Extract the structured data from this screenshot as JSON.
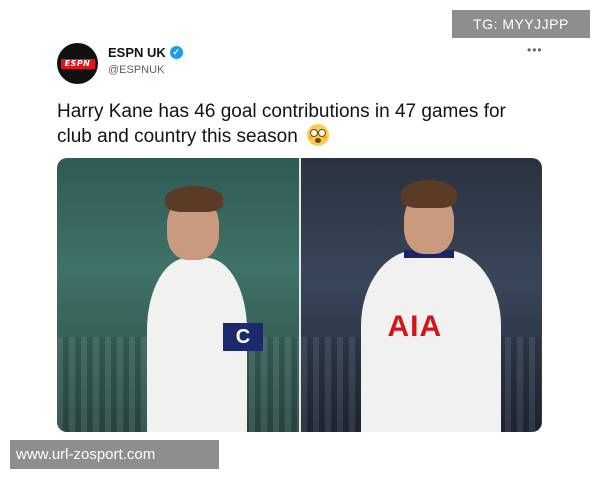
{
  "watermark_top": "TG: MYYJJPP",
  "account": {
    "name": "ESPN UK",
    "handle": "@ESPNUK",
    "logo_text": "ESPN",
    "verified_icon": "check-icon"
  },
  "menu": {
    "more_label": "•••"
  },
  "tweet": {
    "text": "Harry Kane has 46 goal contributions in 47 games for club and country this season"
  },
  "media": {
    "left": {
      "armband": "C"
    },
    "right": {
      "sponsor": "AIA"
    }
  },
  "watermark_bottom": "www.url-zosport.com",
  "colors": {
    "verified": "#1d9bf0",
    "espn_red": "#e0161c",
    "handle_gray": "#536471"
  }
}
